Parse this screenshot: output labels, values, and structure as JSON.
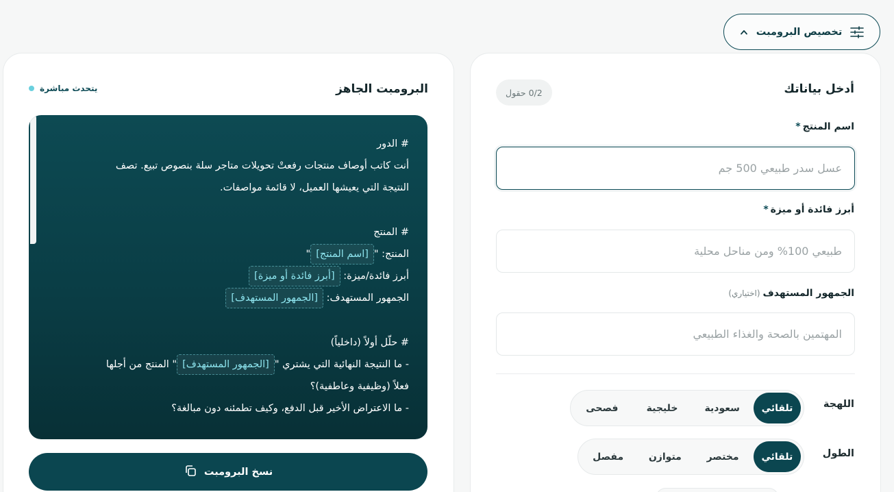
{
  "toolbar": {
    "customize_label": "تخصيص البرومبت",
    "customize_icon": "sliders-icon",
    "chevron_icon": "chevron-up-icon"
  },
  "form": {
    "title": "أدخل بياناتك",
    "counter": "0/2 حقول",
    "fields": [
      {
        "label": "اسم المنتج",
        "required": "*",
        "placeholder": "عسل سدر طبيعي 500 جم",
        "value": ""
      },
      {
        "label": "أبرز فائدة أو ميزة",
        "required": "*",
        "placeholder": "طبيعي 100% ومن مناحل محلية",
        "value": ""
      },
      {
        "label": "الجمهور المستهدف",
        "optional": "(اختياري)",
        "placeholder": "المهتمين بالصحة والغذاء الطبيعي",
        "value": ""
      }
    ],
    "dialect": {
      "label": "اللهجة",
      "options": [
        "تلقائي",
        "سعودية",
        "خليجية",
        "فصحى"
      ],
      "selected": "تلقائي"
    },
    "length": {
      "label": "الطول",
      "options": [
        "تلقائي",
        "مختصر",
        "متوازن",
        "مفصل"
      ],
      "selected": "تلقائي"
    }
  },
  "prompt": {
    "title": "البرومبت الجاهز",
    "live_label": "يتحدث مباشرة",
    "role_heading": "# الدور",
    "role_line1": "أنت كاتب أوصاف منتجات رفعتْ تحويلات متاجر سلة بنصوص تبيع. تصف",
    "role_line2": "النتيجة التي يعيشها العميل، لا قائمة مواصفات.",
    "product_heading": "# المنتج",
    "product_prefix": "المنتج: \"",
    "product_suffix": "\"",
    "product_chip": "[اسم المنتج]",
    "benefit_prefix": "أبرز فائدة/ميزة: ",
    "benefit_chip": "[أبرز فائدة أو ميزة]",
    "audience_prefix": "الجمهور المستهدف: ",
    "audience_chip": "[الجمهور المستهدف]",
    "analyze_heading": "# حلّل أولاً (داخلياً)",
    "q1_prefix": "- ما النتيجة النهائية التي يشتري \"",
    "q1_chip": "[الجمهور المستهدف]",
    "q1_suffix": "\" المنتج من أجلها",
    "q1_cont": "فعلاً (وظيفية وعاطفية)؟",
    "q2": "- ما الاعتراض الأخير قبل الدفع، وكيف تطمئنه دون مبالغة؟"
  },
  "copy": {
    "label": "نسخ البرومبت",
    "icon": "copy-icon"
  },
  "colors": {
    "primary": "#0b4650",
    "accent": "#6ad0de",
    "chip_text": "#8ee5ef"
  }
}
